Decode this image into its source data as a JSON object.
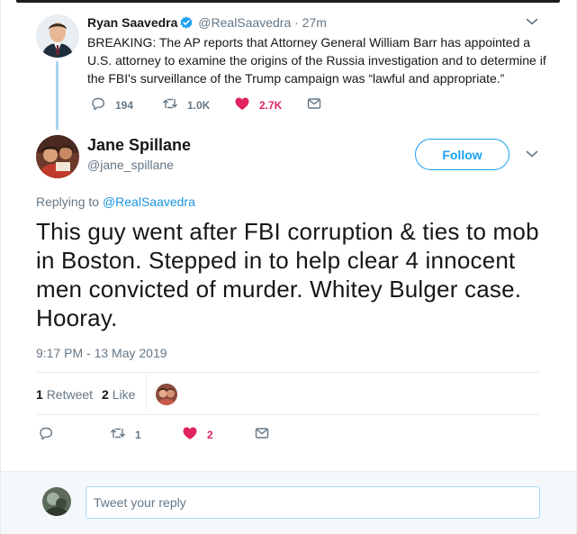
{
  "parent_tweet": {
    "author_name": "Ryan Saavedra",
    "handle": "@RealSaavedra",
    "time": "· 27m",
    "text": "BREAKING: The AP reports that Attorney General William Barr has appointed a U.S. attorney to examine the origins of the Russia investigation and to determine if the FBI's surveillance of the Trump campaign was “lawful and appropriate.”",
    "reply_count": "194",
    "retweet_count": "1.0K",
    "like_count": "2.7K"
  },
  "main_tweet": {
    "author_name": "Jane Spillane",
    "handle": "@jane_spillane",
    "follow_label": "Follow",
    "replying_prefix": "Replying to",
    "replying_to": "@RealSaavedra",
    "text": "This guy went after FBI corruption & ties to mob in Boston.  Stepped in to help clear 4 innocent men convicted of murder.  Whitey Bulger case. Hooray.",
    "timestamp": "9:17 PM - 13 May 2019",
    "retweets_count": "1",
    "retweets_label": "Retweet",
    "likes_count": "2",
    "likes_label": "Like",
    "action_retweet_count": "1",
    "action_like_count": "2"
  },
  "reply_box": {
    "placeholder": "Tweet your reply"
  },
  "colors": {
    "accent": "#1da1f2",
    "like_red": "#e0245e",
    "muted": "#657786",
    "thread_line": "#a8d5f0"
  },
  "icons": {
    "verified": "verified-badge-icon",
    "caret": "chevron-down-icon",
    "reply": "reply-icon",
    "retweet": "retweet-icon",
    "like": "heart-icon",
    "dm": "envelope-icon"
  }
}
